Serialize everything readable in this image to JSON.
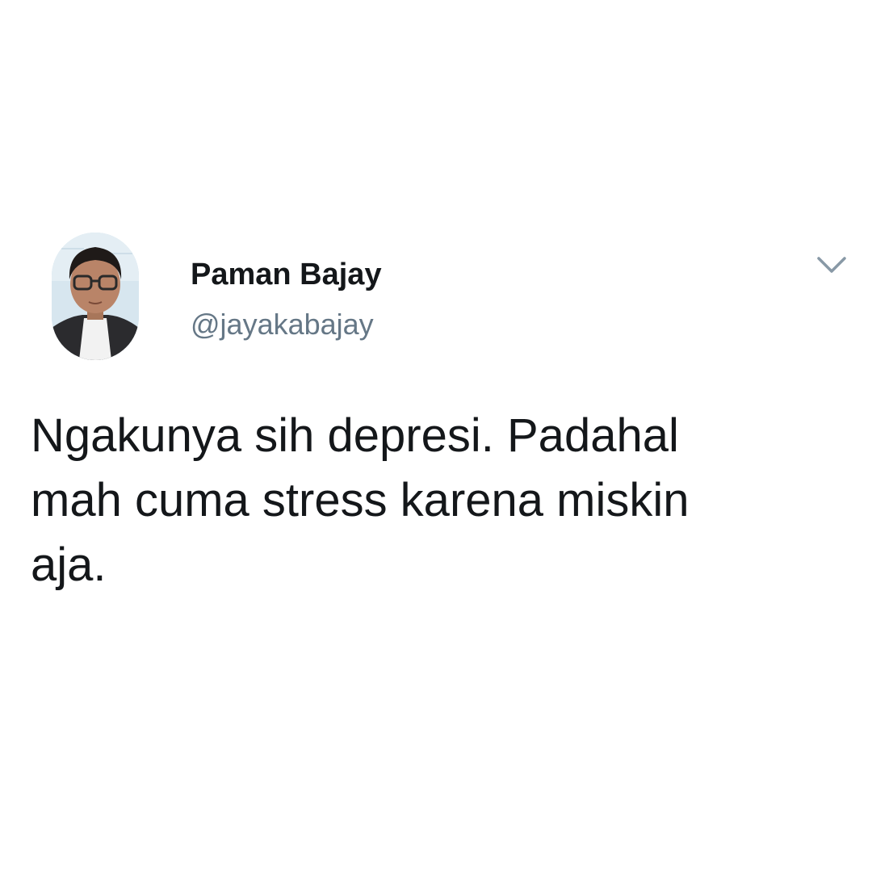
{
  "author": {
    "display_name": "Paman Bajay",
    "handle": "@jayakabajay"
  },
  "tweet": {
    "line1": "Ngakunya sih depresi. Padahal",
    "line2": "mah cuma stress karena miskin",
    "line3": "aja."
  },
  "icons": {
    "menu": "chevron-down-icon"
  },
  "colors": {
    "text": "#14171a",
    "secondary": "#657786",
    "background": "#ffffff"
  }
}
